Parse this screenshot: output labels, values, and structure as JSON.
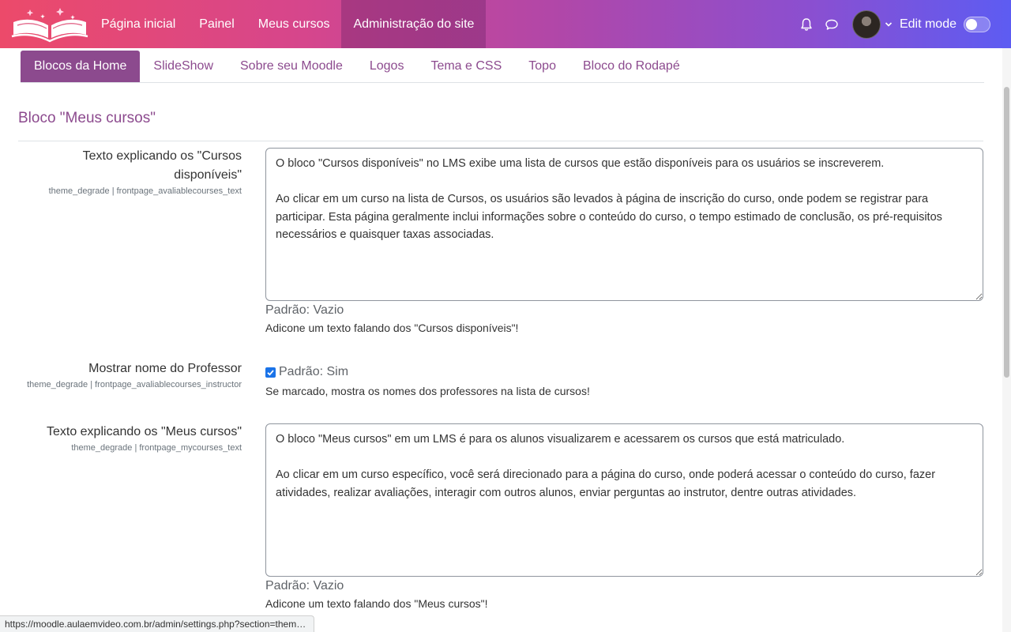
{
  "navbar": {
    "items": [
      {
        "label": "Página inicial"
      },
      {
        "label": "Painel"
      },
      {
        "label": "Meus cursos"
      },
      {
        "label": "Administração do site"
      }
    ],
    "edit_mode_label": "Edit mode",
    "edit_mode_on": false
  },
  "tabs": [
    {
      "label": "Blocos da Home"
    },
    {
      "label": "SlideShow"
    },
    {
      "label": "Sobre seu Moodle"
    },
    {
      "label": "Logos"
    },
    {
      "label": "Tema e CSS"
    },
    {
      "label": "Topo"
    },
    {
      "label": "Bloco do Rodapé"
    }
  ],
  "section": {
    "title": "Bloco \"Meus cursos\""
  },
  "settings": [
    {
      "label": "Texto explicando os \"Cursos disponíveis\"",
      "id": "theme_degrade | frontpage_avaliablecourses_text",
      "value": "O bloco \"Cursos disponíveis\" no LMS exibe uma lista de cursos que estão disponíveis para os usuários se inscreverem.\n\nAo clicar em um curso na lista de Cursos, os usuários são levados à página de inscrição do curso, onde podem se registrar para participar. Esta página geralmente inclui informações sobre o conteúdo do curso, o tempo estimado de conclusão, os pré-requisitos necessários e quaisquer taxas associadas.",
      "default": "Padrão: Vazio",
      "description": "Adicone um texto falando dos \"Cursos disponíveis\"!"
    },
    {
      "label": "Mostrar nome do Professor",
      "id": "theme_degrade | frontpage_avaliablecourses_instructor",
      "checked": true,
      "default": "Padrão: Sim",
      "description": "Se marcado, mostra os nomes dos professores na lista de cursos!"
    },
    {
      "label": "Texto explicando os \"Meus cursos\"",
      "id": "theme_degrade | frontpage_mycourses_text",
      "value": "O bloco \"Meus cursos\" em um LMS é para os alunos visualizarem e acessarem os cursos que está matriculado.\n\nAo clicar em um curso específico, você será direcionado para a página do curso, onde poderá acessar o conteúdo do curso, fazer atividades, realizar avaliações, interagir com outros alunos, enviar perguntas ao instrutor, dentre outras atividades.",
      "default": "Padrão: Vazio",
      "description": "Adicone um texto falando dos \"Meus cursos\"!"
    }
  ],
  "statusbar": {
    "url": "https://moodle.aulaemvideo.com.br/admin/settings.php?section=them…"
  },
  "icons": {
    "logo": "open-book-logo-icon",
    "notifications": "bell-icon",
    "messages": "chat-bubble-icon",
    "user_menu": "chevron-down-icon"
  },
  "colors": {
    "accent": "#8c4a8e",
    "navbar_start": "#ec4a6a",
    "navbar_end": "#5d5cf2",
    "checkbox": "#1a73e8"
  }
}
